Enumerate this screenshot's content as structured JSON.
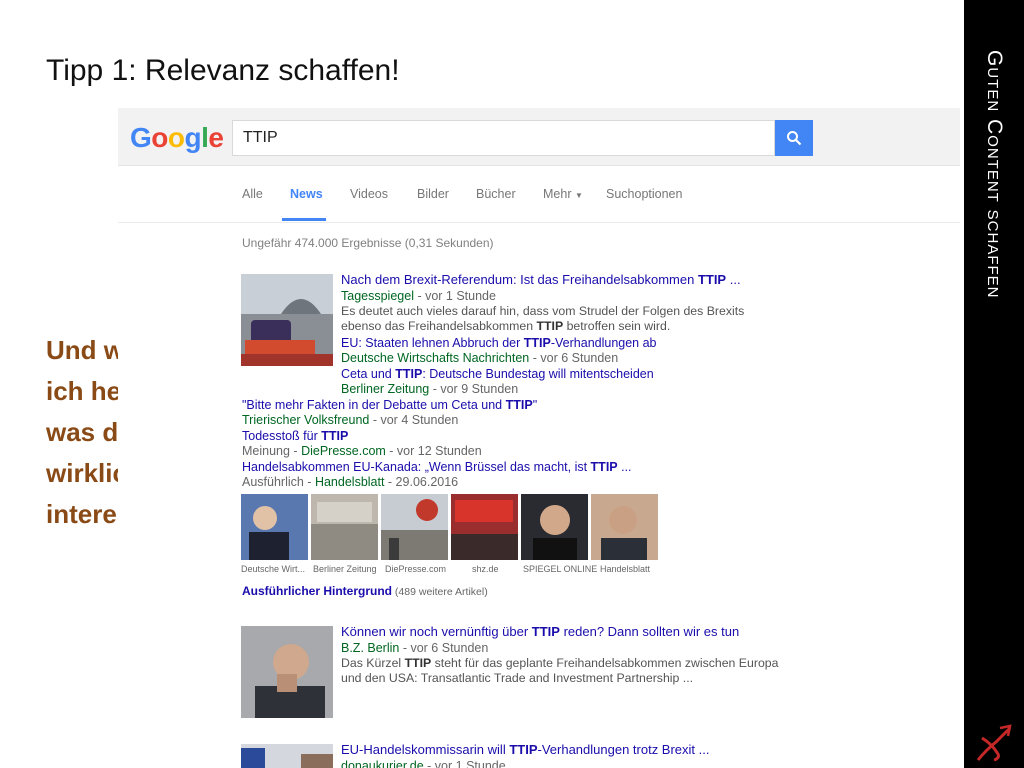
{
  "slide": {
    "title": "Tipp 1: Relevanz schaffen!",
    "question": "Und wie finde ich heraus, was den Leser wirklich interessiert?",
    "side_band": "Guten Content schaffen"
  },
  "google": {
    "logo": [
      "G",
      "o",
      "o",
      "g",
      "l",
      "e"
    ],
    "logo_colors": [
      "#4285f4",
      "#ea4335",
      "#fbbc05",
      "#4285f4",
      "#34a853",
      "#ea4335"
    ],
    "query": "TTIP",
    "tabs": [
      "Alle",
      "News",
      "Videos",
      "Bilder",
      "Bücher",
      "Mehr",
      "Suchoptionen"
    ],
    "active_tab": "News",
    "stats": "Ungefähr 474.000 Ergebnisse (0,31 Sekunden)"
  },
  "results": {
    "r1": {
      "title_a": "Nach dem Brexit-Referendum: Ist das Freihandelsabkommen ",
      "title_b": "TTIP",
      "title_c": " ...",
      "source": "Tagesspiegel",
      "time": " - vor 1 Stunde",
      "snippet_a": "Es deutet auch vieles darauf hin, dass vom Strudel der Folgen des Brexits ebenso das Freihandelsabkommen ",
      "snippet_b": "TTIP",
      "snippet_c": " betroffen sein wird."
    },
    "sub": [
      {
        "t1": "EU: Staaten lehnen Abbruch der ",
        "t2": "TTIP",
        "t3": "-Verhandlungen ab",
        "s1": "",
        "s2": "Deutsche Wirtschafts Nachrichten",
        "s3": " - vor 6 Stunden"
      },
      {
        "t1": "Ceta und ",
        "t2": "TTIP",
        "t3": ": Deutsche Bundestag will mitentscheiden",
        "s1": "",
        "s2": "Berliner Zeitung",
        "s3": " - vor 9 Stunden"
      },
      {
        "t1": "\"Bitte mehr Fakten in der Debatte um Ceta und ",
        "t2": "TTIP",
        "t3": "\"",
        "s1": "",
        "s2": "Trierischer Volksfreund",
        "s3": " - vor 4 Stunden"
      },
      {
        "t1": "Todesstoß für ",
        "t2": "TTIP",
        "t3": "",
        "s1": "Meinung - ",
        "s2": "DiePresse.com",
        "s3": " - vor 12 Stunden"
      },
      {
        "t1": "Handelsabkommen EU-Kanada: „Wenn Brüssel das macht, ist ",
        "t2": "TTIP",
        "t3": " ...",
        "s1": "Ausführlich - ",
        "s2": "Handelsblatt",
        "s3": " - 29.06.2016"
      }
    ],
    "thumbs": [
      "Deutsche Wirt...",
      "Berliner Zeitung",
      "DiePresse.com",
      "shz.de",
      "SPIEGEL ONLINE",
      "Handelsblatt"
    ],
    "more_link": "Ausführlicher Hintergrund",
    "more_count": " (489 weitere Artikel)",
    "r2": {
      "title_a": "Können wir noch vernünftig über ",
      "title_b": "TTIP",
      "title_c": " reden? Dann sollten wir es tun",
      "source": "B.Z. Berlin",
      "time": " - vor 6 Stunden",
      "snippet_a": "Das Kürzel ",
      "snippet_b": "TTIP",
      "snippet_c": " steht für das geplante Freihandelsabkommen zwischen Europa und den USA: Transatlantic Trade and Investment Partnership ..."
    },
    "r3": {
      "title_a": "EU-Handelskommissarin will ",
      "title_b": "TTIP",
      "title_c": "-Verhandlungen trotz Brexit ...",
      "source": "donaukurier.de",
      "time": " - vor 1 Stunde"
    }
  }
}
